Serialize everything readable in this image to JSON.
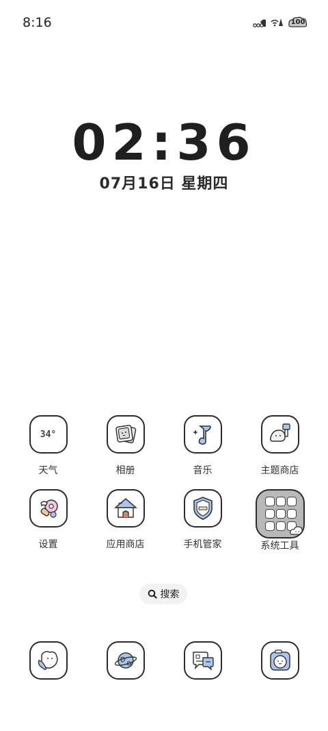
{
  "status_bar": {
    "time": "8:16",
    "signal_icon": "signal-icon",
    "wifi_icon": "wifi-icon",
    "battery_level": "100"
  },
  "clock": {
    "time": "02:36",
    "date": "07月16日 星期四"
  },
  "apps": [
    {
      "label": "天气",
      "icon": "weather-icon",
      "value": "34°"
    },
    {
      "label": "相册",
      "icon": "gallery-icon"
    },
    {
      "label": "音乐",
      "icon": "music-icon"
    },
    {
      "label": "主题商店",
      "icon": "theme-store-icon"
    },
    {
      "label": "设置",
      "icon": "settings-icon"
    },
    {
      "label": "应用商店",
      "icon": "app-store-icon"
    },
    {
      "label": "手机管家",
      "icon": "phone-manager-icon"
    },
    {
      "label": "系统工具",
      "icon": "system-tools-folder-icon"
    }
  ],
  "search": {
    "label": "搜索"
  },
  "dock": [
    {
      "icon": "phone-icon"
    },
    {
      "icon": "browser-icon"
    },
    {
      "icon": "messages-icon"
    },
    {
      "icon": "camera-icon"
    }
  ]
}
